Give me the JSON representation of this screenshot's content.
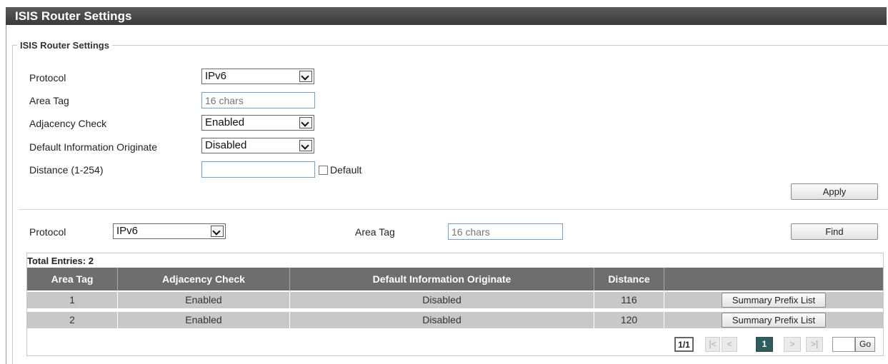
{
  "page": {
    "title": "ISIS Router Settings",
    "section_legend": "ISIS Router Settings"
  },
  "settings": {
    "protocol": {
      "label": "Protocol",
      "value": "IPv6"
    },
    "area_tag": {
      "label": "Area Tag",
      "placeholder": "16 chars"
    },
    "adjacency_check": {
      "label": "Adjacency Check",
      "value": "Enabled"
    },
    "default_info": {
      "label": "Default Information Originate",
      "value": "Disabled"
    },
    "distance": {
      "label": "Distance (1-254)",
      "value": "",
      "default_label": "Default",
      "default_checked": false
    },
    "apply_label": "Apply"
  },
  "search": {
    "protocol_label": "Protocol",
    "protocol_value": "IPv6",
    "area_tag_label": "Area Tag",
    "area_tag_placeholder": "16 chars",
    "find_label": "Find"
  },
  "table": {
    "total_label": "Total Entries: 2",
    "headers": [
      "Area Tag",
      "Adjacency Check",
      "Default Information Originate",
      "Distance",
      ""
    ],
    "rows": [
      {
        "area_tag": "1",
        "adjacency": "Enabled",
        "default_info": "Disabled",
        "distance": "116",
        "action": "Summary Prefix List"
      },
      {
        "area_tag": "2",
        "adjacency": "Enabled",
        "default_info": "Disabled",
        "distance": "120",
        "action": "Summary Prefix List"
      }
    ]
  },
  "pager": {
    "indicator": "1/1",
    "first": "|<",
    "prev": "<",
    "current": "1",
    "next": ">",
    "last": ">|",
    "go_label": "Go",
    "goto_value": ""
  },
  "colors": {
    "title_bar": "#3f3f3f",
    "table_header": "#6e6e6e",
    "row_bg": "#c8c8c8",
    "current_page": "#2f5c5c"
  }
}
